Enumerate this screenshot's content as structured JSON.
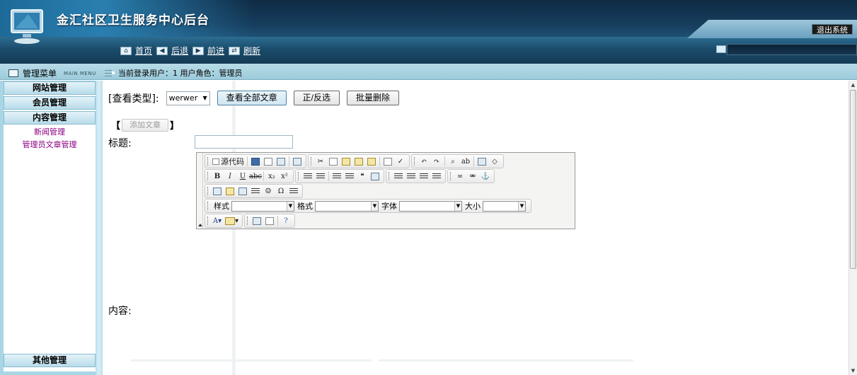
{
  "header": {
    "title": "金汇社区卫生服务中心后台",
    "logout_label": "退出系统",
    "nav": [
      {
        "icon": "home-icon",
        "label": "首页"
      },
      {
        "icon": "arrow-left-icon",
        "label": "后退"
      },
      {
        "icon": "arrow-right-icon",
        "label": "前进"
      },
      {
        "icon": "refresh-icon",
        "label": "刷新"
      }
    ]
  },
  "infobar": {
    "menu_title": "管理菜单",
    "menu_subtitle": "MAIN MENU",
    "user_info": "当前登录用户：1 用户角色：管理员"
  },
  "sidebar": {
    "sections": [
      "网站管理",
      "会员管理",
      "内容管理"
    ],
    "links": [
      "新闻管理",
      "管理员文章管理"
    ],
    "bottom_section": "其他管理"
  },
  "main": {
    "type_label": "[查看类型]:",
    "type_select_value": "werwer",
    "view_all_label": "查看全部文章",
    "invert_label": "正/反选",
    "batch_delete_label": "批量删除",
    "add_bracket_left": "【",
    "add_article_label": "添加文章",
    "add_bracket_right": "】",
    "title_label": "标题:",
    "title_value": "",
    "content_label": "内容:"
  },
  "editor": {
    "source_label": "源代码",
    "style_label": "样式",
    "format_label": "格式",
    "font_label": "字体",
    "size_label": "大小"
  },
  "colors": {
    "header_dark": "#0f2b44",
    "sidebar_bg": "#a9d6e5",
    "link_purple": "#8b0080"
  }
}
